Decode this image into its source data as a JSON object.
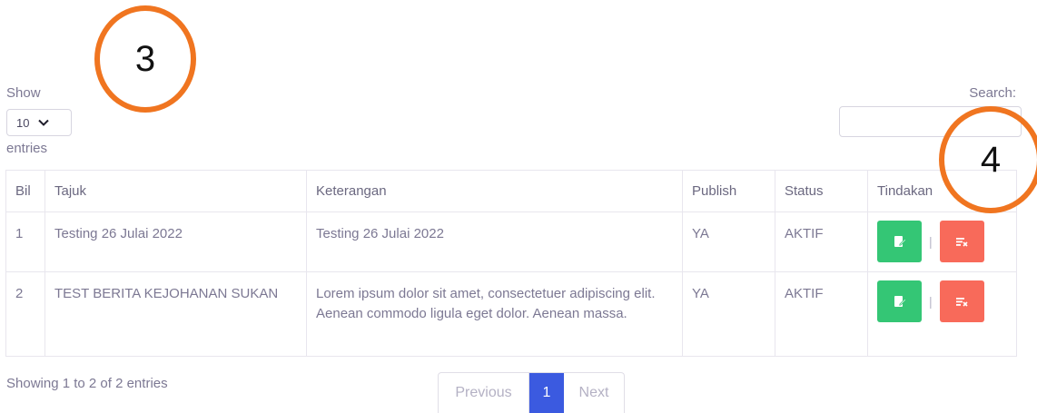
{
  "length": {
    "show_label": "Show",
    "selected": "10",
    "entries_label": "entries"
  },
  "search": {
    "label": "Search:",
    "value": ""
  },
  "table": {
    "headers": [
      "Bil",
      "Tajuk",
      "Keterangan",
      "Publish",
      "Status",
      "Tindakan"
    ],
    "rows": [
      {
        "bil": "1",
        "tajuk": "Testing 26 Julai 2022",
        "keterangan": "Testing 26 Julai 2022",
        "publish": "YA",
        "status": "AKTIF"
      },
      {
        "bil": "2",
        "tajuk": "TEST BERITA KEJOHANAN SUKAN",
        "keterangan": "Lorem ipsum dolor sit amet, consectetuer adipiscing elit. Aenean commodo ligula eget dolor. Aenean massa.",
        "publish": "YA",
        "status": "AKTIF"
      }
    ],
    "action_separator": "|",
    "edit_icon": "edit-icon",
    "delete_icon": "delete-icon"
  },
  "footer": {
    "info": "Showing 1 to 2 of 2 entries",
    "prev_label": "Previous",
    "page_current": "1",
    "next_label": "Next"
  },
  "annotations": {
    "circle_left": "3",
    "circle_right": "4"
  },
  "colors": {
    "edit_button": "#34c675",
    "delete_button": "#f86a5a",
    "active_page": "#3b5ae0",
    "annotation": "#f07520"
  }
}
